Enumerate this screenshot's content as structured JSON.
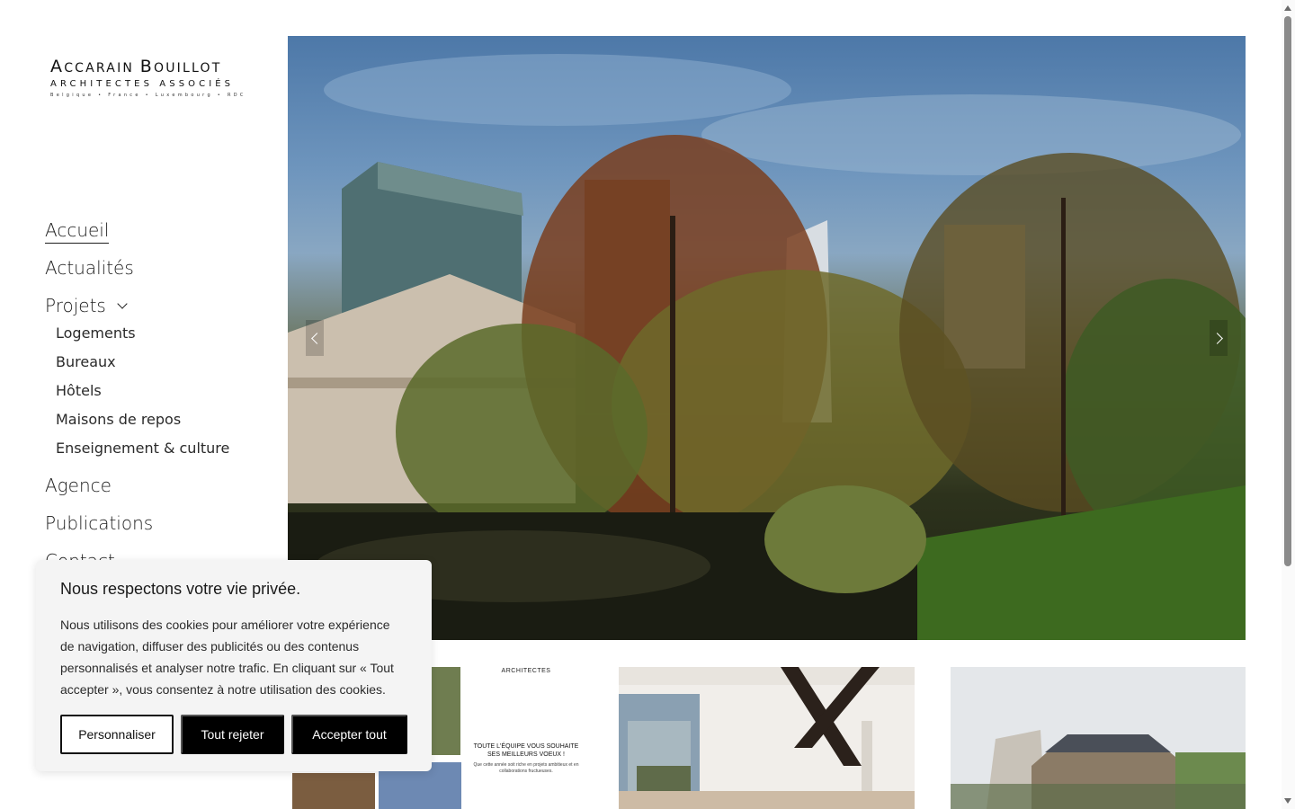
{
  "logo": {
    "main_cap_a": "A",
    "main_rest_a": "ccarain ",
    "main_cap_b": "B",
    "main_rest_b": "ouillot",
    "subtitle": "Architectes Associés",
    "locations": "Belgique • France • Luxembourg • RDC"
  },
  "nav": {
    "items": [
      {
        "label": "Accueil"
      },
      {
        "label": "Actualités"
      },
      {
        "label": "Projets"
      },
      {
        "label": "Agence"
      },
      {
        "label": "Publications"
      },
      {
        "label": "Contact"
      }
    ],
    "projets_sub": [
      {
        "label": "Logements"
      },
      {
        "label": "Bureaux"
      },
      {
        "label": "Hôtels"
      },
      {
        "label": "Maisons de repos"
      },
      {
        "label": "Enseignement & culture"
      }
    ]
  },
  "thumbs": {
    "t1_heading": "ACCARAIN BOUILLOT ARCHITECTES",
    "t1_wish": "TOUTE L'ÉQUIPE VOUS SOUHAITE SES MEILLEURS VOEUX !",
    "t1_note": "Que cette année soit riche en projets ambitieux et en collaborations fructueuses."
  },
  "cookie": {
    "title": "Nous respectons votre vie privée.",
    "text": "Nous utilisons des cookies pour améliorer votre expérience de navigation, diffuser des publicités ou des contenus personnalisés et analyser notre trafic. En cliquant sur « Tout accepter », vous consentez à notre utilisation des cookies.",
    "btn_customize": "Personnaliser",
    "btn_reject": "Tout rejeter",
    "btn_accept": "Accepter tout"
  }
}
